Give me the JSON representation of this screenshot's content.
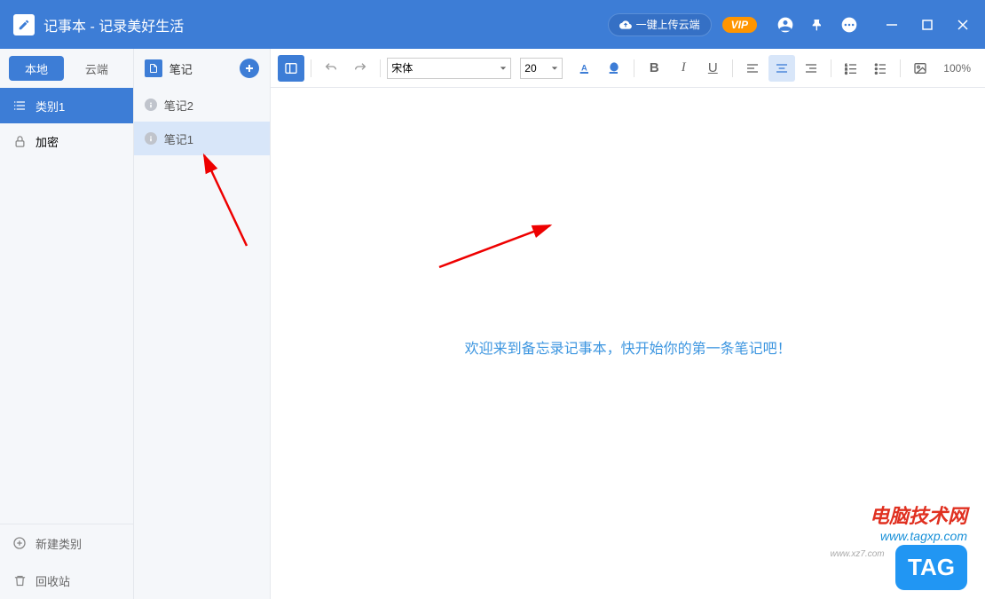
{
  "titlebar": {
    "app_title": "记事本 - 记录美好生活",
    "cloud_button": "一键上传云端",
    "vip": "VIP"
  },
  "sidebar": {
    "tabs": {
      "local": "本地",
      "cloud": "云端"
    },
    "categories": {
      "category1": "类别1",
      "encrypted": "加密"
    },
    "actions": {
      "new_category": "新建类别",
      "recycle_bin": "回收站"
    }
  },
  "notes": {
    "header": "笔记",
    "items": [
      {
        "label": "笔记2"
      },
      {
        "label": "笔记1"
      }
    ]
  },
  "toolbar": {
    "font": "宋体",
    "size": "20",
    "zoom": "100%"
  },
  "editor": {
    "welcome": "欢迎来到备忘录记事本，快开始你的第一条笔记吧！"
  },
  "watermark": {
    "title": "电脑技术网",
    "url": "www.tagxp.com",
    "sub": "www.xz7.com",
    "tag": "TAG"
  }
}
